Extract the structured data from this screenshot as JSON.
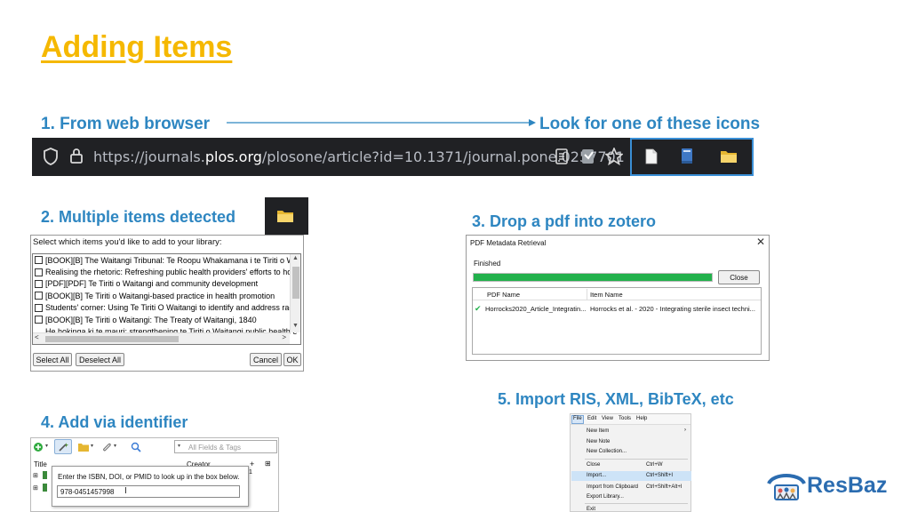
{
  "title": "Adding Items",
  "step1": {
    "label": "1. From web browser",
    "target": "Look for one of these icons"
  },
  "browser": {
    "url_prefix": "https://journals.",
    "url_domain": "plos.org",
    "url_suffix": "/plosone/article?id=10.1371/journal.pone.0257701"
  },
  "step2": {
    "label": "2. Multiple items detected",
    "prompt": "Select which items you'd like to add to your library:",
    "items": [
      "[BOOK][B] The Waitangi Tribunal: Te Roopu Whakamana i te Tiriti o Wait",
      "Realising the rhetoric: Refreshing public health providers' efforts to hon",
      "[PDF][PDF] Te Tiriti o Waitangi and community development",
      "[BOOK][B] Te Tiriti o Waitangi-based practice in health promotion",
      "Students' corner: Using Te Tiriti O Waitangi to identify and address racis",
      "[BOOK][B] Te Tiriti o Waitangi: The Treaty of Waitangi, 1840",
      "He hokinga ki te mauri: strengthening te Tiriti o Waitangi public health e"
    ],
    "select_all": "Select All",
    "deselect_all": "Deselect All",
    "cancel": "Cancel",
    "ok": "OK"
  },
  "step3": {
    "label": "3. Drop a pdf into zotero",
    "dialog_title": "PDF Metadata Retrieval",
    "status": "Finished",
    "progress": 1.0,
    "close": "Close",
    "col_pdf": "PDF Name",
    "col_item": "Item Name",
    "row_pdf": "Horrocks2020_Article_Integratin...",
    "row_item": "Horrocks et al. - 2020 - Integrating sterile insect techni..."
  },
  "step4": {
    "label": "4. Add via identifier",
    "search_placeholder": "All Fields & Tags",
    "col_title": "Title",
    "col_creator": "Creator",
    "prompt": "Enter the ISBN, DOI, or PMID to look up in the box below.",
    "value": "978-0451457998"
  },
  "step5": {
    "label": "5. Import RIS, XML, BibTeX, etc",
    "menubar": [
      "File",
      "Edit",
      "View",
      "Tools",
      "Help"
    ],
    "items": [
      {
        "label": "New Item",
        "shortcut": ""
      },
      {
        "label": "New Note",
        "shortcut": ""
      },
      {
        "label": "New Collection...",
        "shortcut": ""
      },
      {
        "label": "Close",
        "shortcut": "Ctrl+W"
      },
      {
        "label": "Import...",
        "shortcut": "Ctrl+Shift+I"
      },
      {
        "label": "Import from Clipboard",
        "shortcut": "Ctrl+Shift+Alt+I"
      },
      {
        "label": "Export Library...",
        "shortcut": ""
      },
      {
        "label": "Exit",
        "shortcut": ""
      }
    ]
  },
  "logo": {
    "text": "ResBaz"
  },
  "colors": {
    "title": "#f5b800",
    "heading": "#2e86c1",
    "progress": "#22b14c",
    "logo": "#2b6cb0"
  }
}
